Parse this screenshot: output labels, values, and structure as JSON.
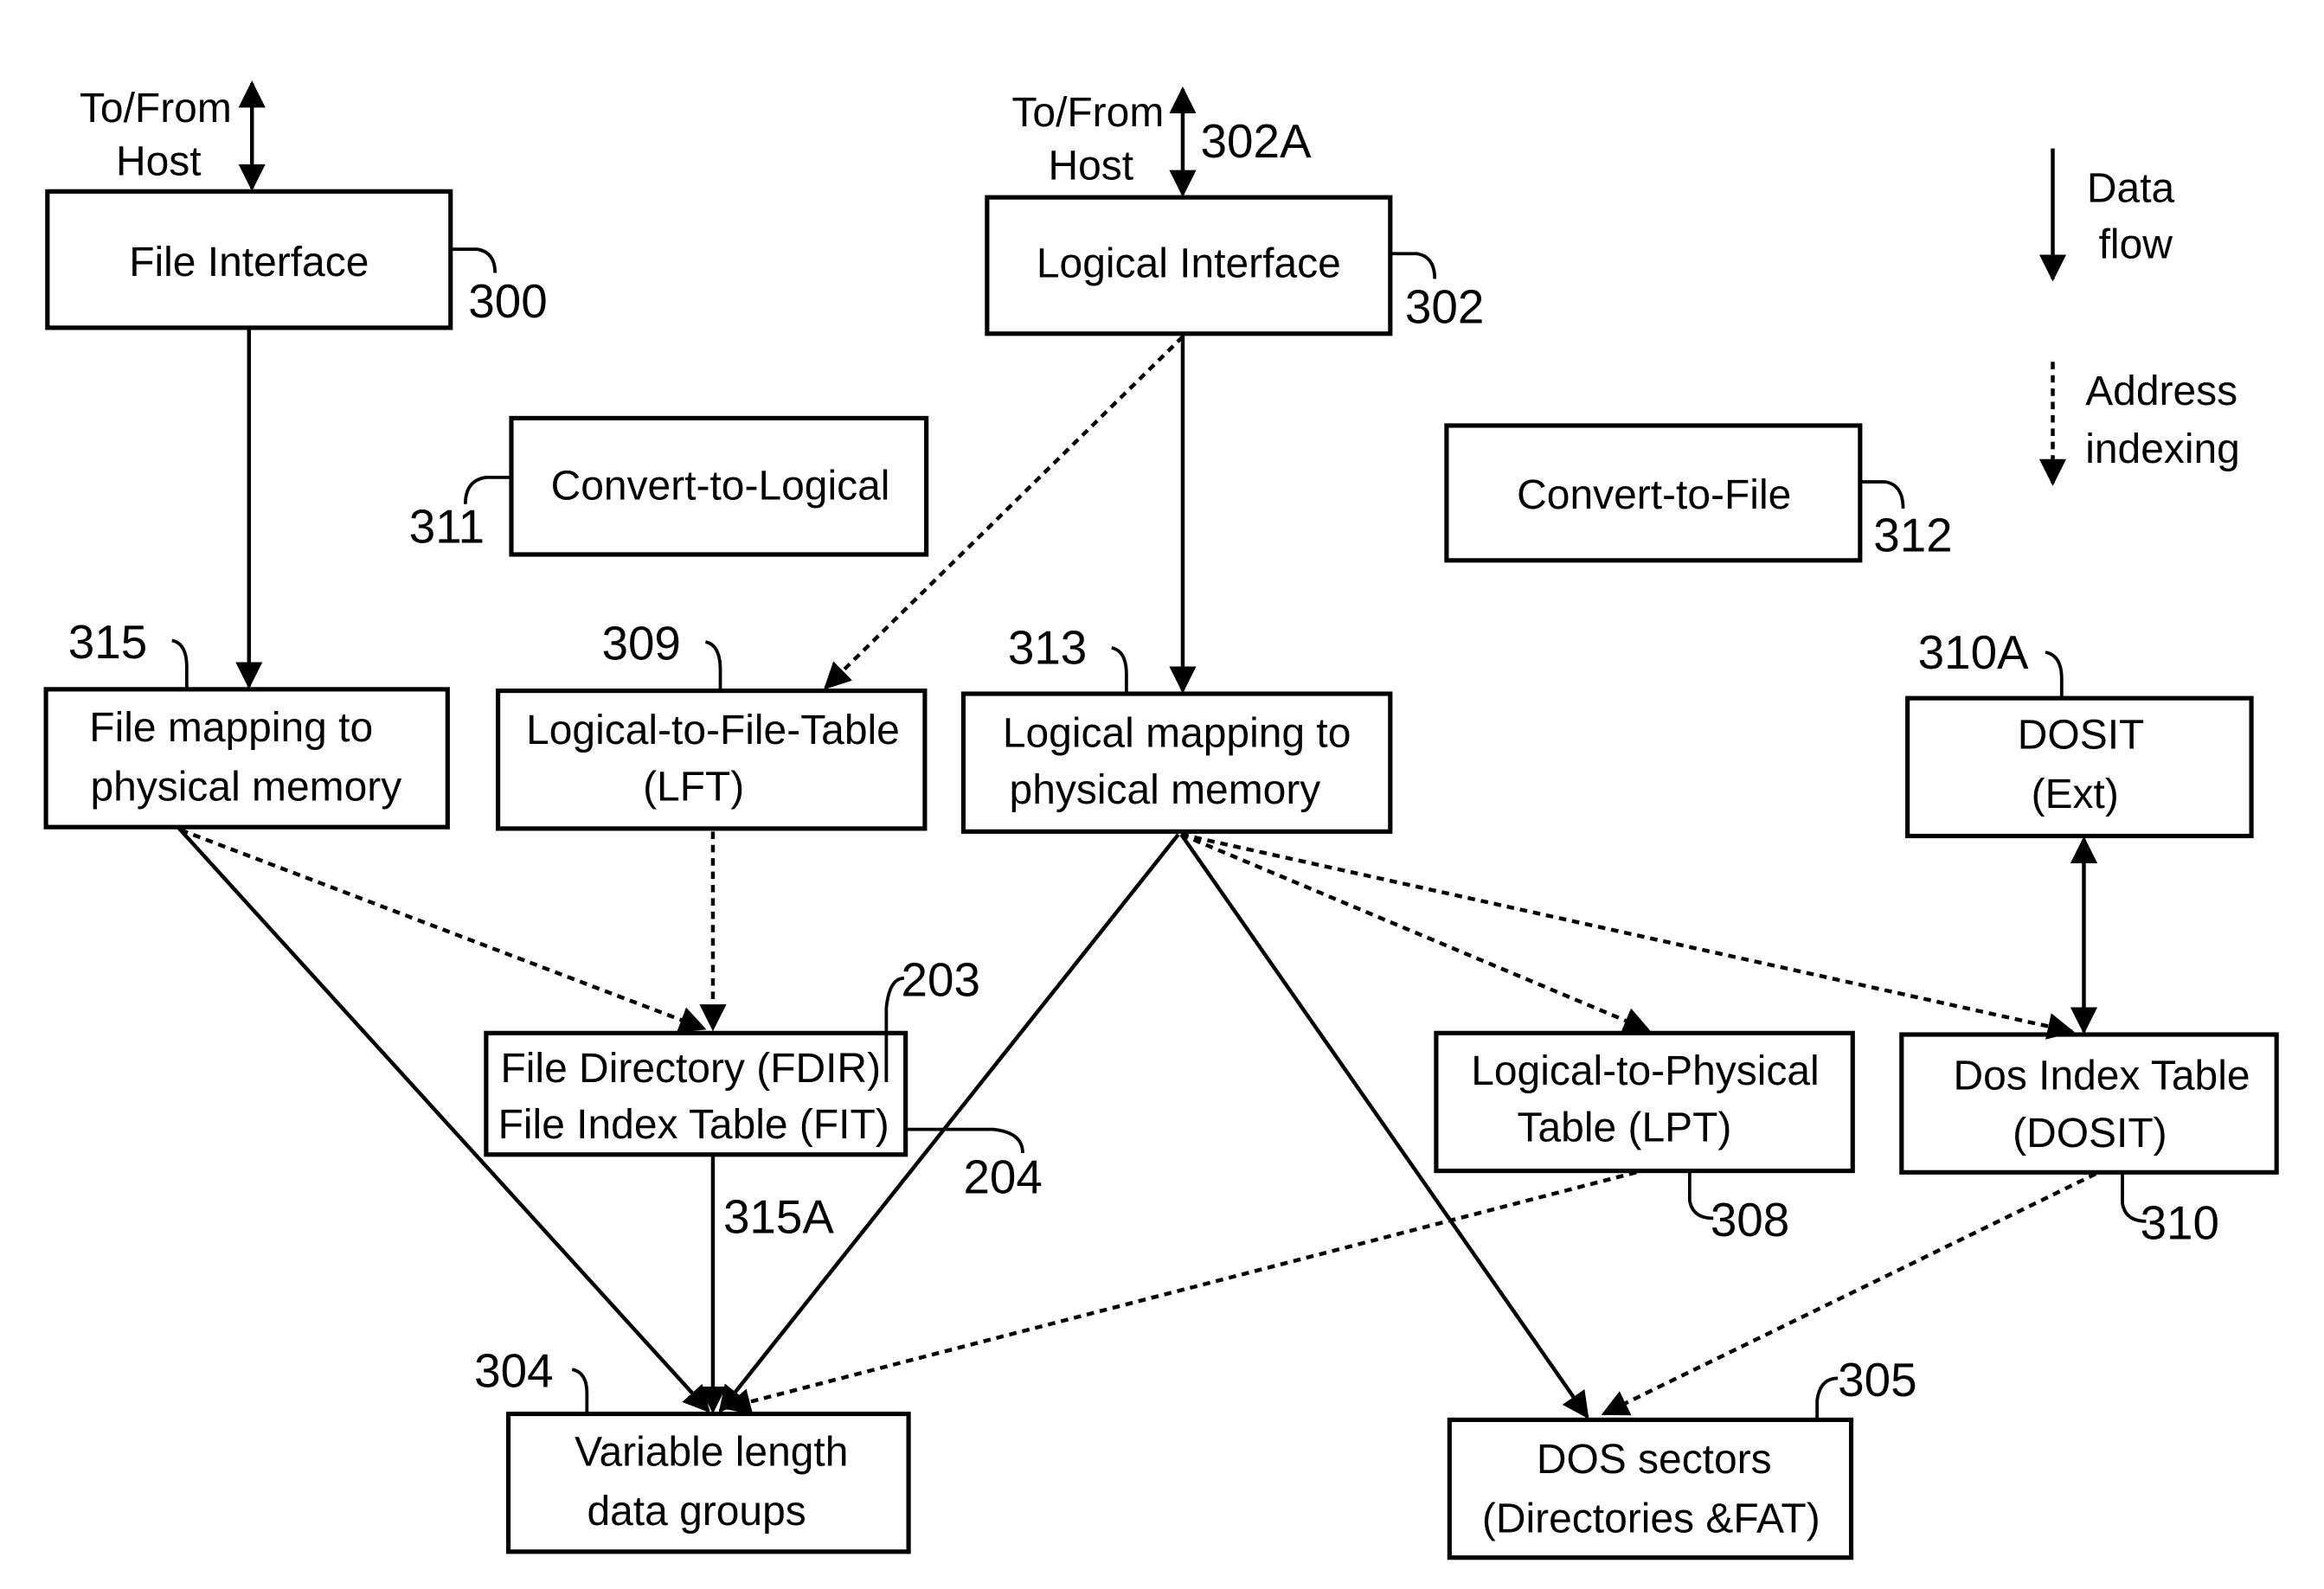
{
  "diagram": {
    "host_label_left": [
      "To/From",
      "Host"
    ],
    "host_label_right": [
      "To/From",
      "Host"
    ],
    "boxes": {
      "file_interface": {
        "lines": [
          "File Interface"
        ],
        "ref": "300"
      },
      "logical_interface": {
        "lines": [
          "Logical Interface"
        ],
        "ref": "302",
        "host_ref": "302A"
      },
      "convert_to_logical": {
        "lines": [
          "Convert-to-Logical"
        ],
        "ref": "311"
      },
      "convert_to_file": {
        "lines": [
          "Convert-to-File"
        ],
        "ref": "312"
      },
      "file_mapping": {
        "lines": [
          "File mapping to",
          "physical memory"
        ],
        "ref": "315"
      },
      "lft": {
        "lines": [
          "Logical-to-File-Table",
          "(LFT)"
        ],
        "ref": "309"
      },
      "logical_mapping": {
        "lines": [
          "Logical mapping to",
          "physical memory"
        ],
        "ref": "313"
      },
      "dosit_ext": {
        "lines": [
          "DOSIT",
          "(Ext)"
        ],
        "ref": "310A"
      },
      "fdir_fit": {
        "lines": [
          "File Directory (FDIR)",
          "File Index Table (FIT)"
        ],
        "ref_fdir": "203",
        "ref_fit": "204",
        "ref_link": "315A"
      },
      "lpt": {
        "lines": [
          "Logical-to-Physical",
          "Table (LPT)"
        ],
        "ref": "308"
      },
      "dosit": {
        "lines": [
          "Dos Index Table",
          "(DOSIT)"
        ],
        "ref": "310"
      },
      "variable_length": {
        "lines": [
          "Variable length",
          "data groups"
        ],
        "ref": "304"
      },
      "dos_sectors": {
        "lines": [
          "DOS sectors",
          "(Directories &FAT)"
        ],
        "ref": "305"
      }
    },
    "legend": {
      "data_flow": [
        "Data",
        "flow"
      ],
      "address_indexing": [
        "Address",
        "indexing"
      ]
    }
  }
}
